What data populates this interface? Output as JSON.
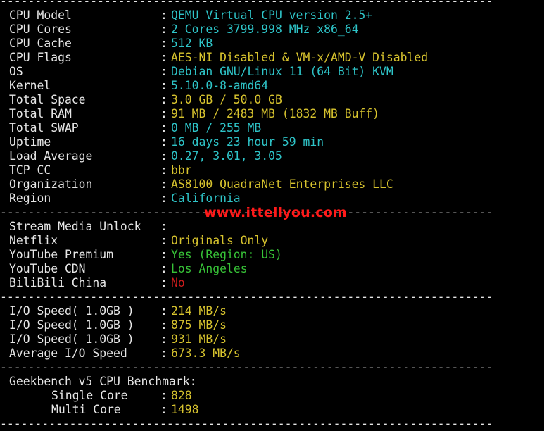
{
  "separator": "-----------------------------------------------------------------------",
  "system": {
    "rows": [
      {
        "label": "CPU Model",
        "value": "QEMU Virtual CPU version 2.5+",
        "color": "cyan"
      },
      {
        "label": "CPU Cores",
        "value": "2 Cores 3799.998 MHz x86_64",
        "color": "cyan"
      },
      {
        "label": "CPU Cache",
        "value": "512 KB",
        "color": "cyan"
      },
      {
        "label": "CPU Flags",
        "value": "AES-NI Disabled & VM-x/AMD-V Disabled",
        "color": "yellow"
      },
      {
        "label": "OS",
        "value": "Debian GNU/Linux 11 (64 Bit) KVM",
        "color": "cyan"
      },
      {
        "label": "Kernel",
        "value": "5.10.0-8-amd64",
        "color": "cyan"
      },
      {
        "label": "Total Space",
        "value": "3.0 GB / 50.0 GB",
        "color": "yellow"
      },
      {
        "label": "Total RAM",
        "value": "91 MB / 2483 MB (1832 MB Buff)",
        "color": "yellow"
      },
      {
        "label": "Total SWAP",
        "value": "0 MB / 255 MB",
        "color": "cyan"
      },
      {
        "label": "Uptime",
        "value": "16 days 23 hour 59 min",
        "color": "cyan"
      },
      {
        "label": "Load Average",
        "value": "0.27, 3.01, 3.05",
        "color": "cyan"
      },
      {
        "label": "TCP CC",
        "value": "bbr",
        "color": "yellow"
      },
      {
        "label": "Organization",
        "value": "AS8100 QuadraNet Enterprises LLC",
        "color": "yellow"
      },
      {
        "label": "Region",
        "value": "California",
        "color": "cyan"
      }
    ]
  },
  "watermark": "www.ittellyou.com",
  "media": {
    "heading": "Stream Media Unlock",
    "rows": [
      {
        "label": "Netflix",
        "value": "Originals Only",
        "color": "yellow"
      },
      {
        "label": "YouTube Premium",
        "value": "Yes (Region: US)",
        "color": "green"
      },
      {
        "label": "YouTube CDN",
        "value": "Los Angeles",
        "color": "green"
      },
      {
        "label": "BiliBili China",
        "value": "No",
        "color": "red"
      }
    ]
  },
  "io": {
    "rows": [
      {
        "label": "I/O Speed( 1.0GB )",
        "value": "214 MB/s",
        "color": "yellow"
      },
      {
        "label": "I/O Speed( 1.0GB )",
        "value": "875 MB/s",
        "color": "yellow"
      },
      {
        "label": "I/O Speed( 1.0GB )",
        "value": "931 MB/s",
        "color": "yellow"
      },
      {
        "label": "Average I/O Speed",
        "value": "673.3 MB/s",
        "color": "yellow"
      }
    ]
  },
  "geekbench": {
    "heading": "Geekbench v5 CPU Benchmark:",
    "rows": [
      {
        "label": "Single Core",
        "value": "828",
        "color": "yellow"
      },
      {
        "label": "Multi Core",
        "value": "1498",
        "color": "yellow"
      }
    ]
  },
  "colors": {
    "background": "#000000",
    "text": "#e6e6e6",
    "cyan": "#2ec4c8",
    "yellow": "#d7c32e",
    "green": "#37c237",
    "red": "#d01d1d",
    "watermark": "#ff1a1a"
  }
}
